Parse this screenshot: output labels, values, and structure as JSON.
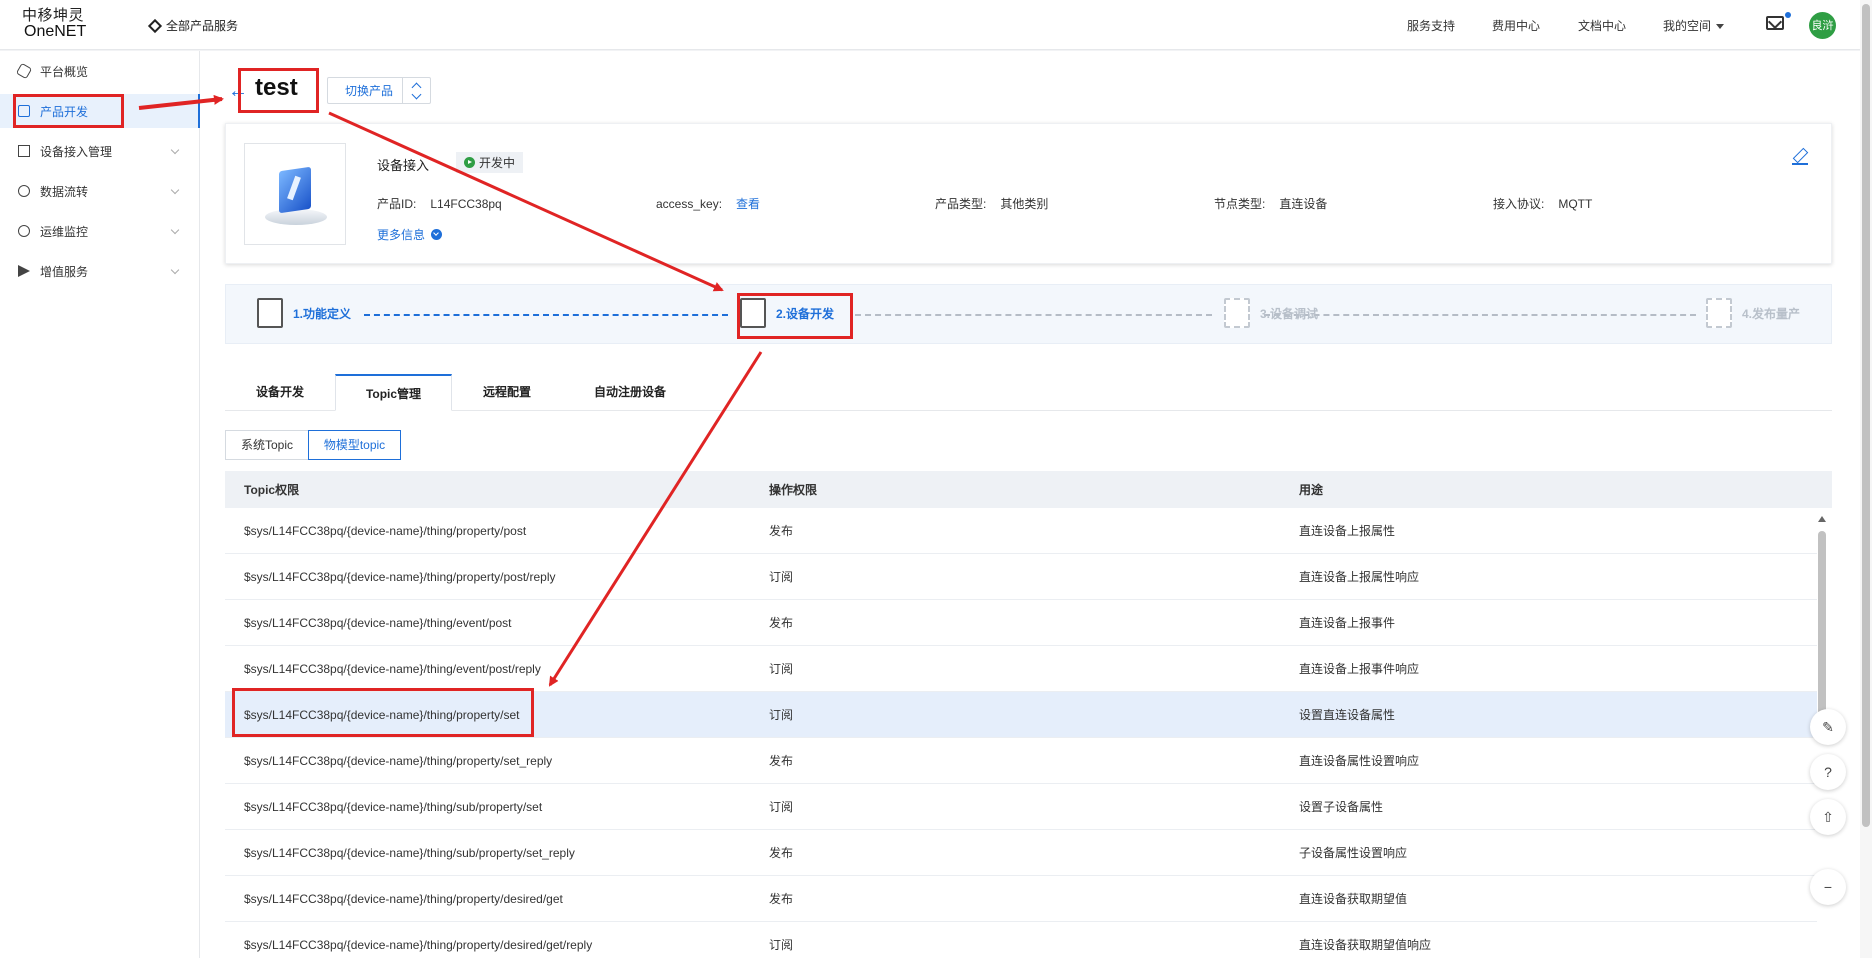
{
  "topbar": {
    "logo_line1": "中移坤灵",
    "logo_line2": "OneNET",
    "all_products": "全部产品服务",
    "nav": [
      "服务支持",
      "费用中心",
      "文档中心",
      "我的空间"
    ],
    "avatar_text": "良浒"
  },
  "sidebar": {
    "items": [
      {
        "label": "平台概览",
        "icon": "overview-icon"
      },
      {
        "label": "产品开发",
        "icon": "cube-icon"
      },
      {
        "label": "设备接入管理",
        "icon": "device-icon"
      },
      {
        "label": "数据流转",
        "icon": "flow-icon"
      },
      {
        "label": "运维监控",
        "icon": "monitor-icon"
      },
      {
        "label": "增值服务",
        "icon": "send-icon"
      }
    ]
  },
  "product": {
    "title": "test",
    "switch_label": "切换产品",
    "name": "设备接入",
    "status": "开发中",
    "id_label": "产品ID:",
    "id_value": "L14FCC38pq",
    "key_label": "access_key:",
    "key_value": "查看",
    "type_label": "产品类型:",
    "type_value": "其他类别",
    "node_label": "节点类型:",
    "node_value": "直连设备",
    "proto_label": "接入协议:",
    "proto_value": "MQTT",
    "more": "更多信息"
  },
  "steps": [
    "1.功能定义",
    "2.设备开发",
    "3.设备调试",
    "4.发布量产"
  ],
  "tabs": [
    "设备开发",
    "Topic管理",
    "远程配置",
    "自动注册设备"
  ],
  "subtabs": [
    "系统Topic",
    "物模型topic"
  ],
  "table": {
    "headers": [
      "Topic权限",
      "操作权限",
      "用途"
    ],
    "rows": [
      [
        "$sys/L14FCC38pq/{device-name}/thing/property/post",
        "发布",
        "直连设备上报属性"
      ],
      [
        "$sys/L14FCC38pq/{device-name}/thing/property/post/reply",
        "订阅",
        "直连设备上报属性响应"
      ],
      [
        "$sys/L14FCC38pq/{device-name}/thing/event/post",
        "发布",
        "直连设备上报事件"
      ],
      [
        "$sys/L14FCC38pq/{device-name}/thing/event/post/reply",
        "订阅",
        "直连设备上报事件响应"
      ],
      [
        "$sys/L14FCC38pq/{device-name}/thing/property/set",
        "订阅",
        "设置直连设备属性"
      ],
      [
        "$sys/L14FCC38pq/{device-name}/thing/property/set_reply",
        "发布",
        "直连设备属性设置响应"
      ],
      [
        "$sys/L14FCC38pq/{device-name}/thing/sub/property/set",
        "订阅",
        "设置子设备属性"
      ],
      [
        "$sys/L14FCC38pq/{device-name}/thing/sub/property/set_reply",
        "发布",
        "子设备属性设置响应"
      ],
      [
        "$sys/L14FCC38pq/{device-name}/thing/property/desired/get",
        "发布",
        "直连设备获取期望值"
      ],
      [
        "$sys/L14FCC38pq/{device-name}/thing/property/desired/get/reply",
        "订阅",
        "直连设备获取期望值响应"
      ]
    ]
  },
  "colors": {
    "accent": "#1e6fd9",
    "annotation": "#e02424",
    "status_green": "#2f9e44"
  }
}
